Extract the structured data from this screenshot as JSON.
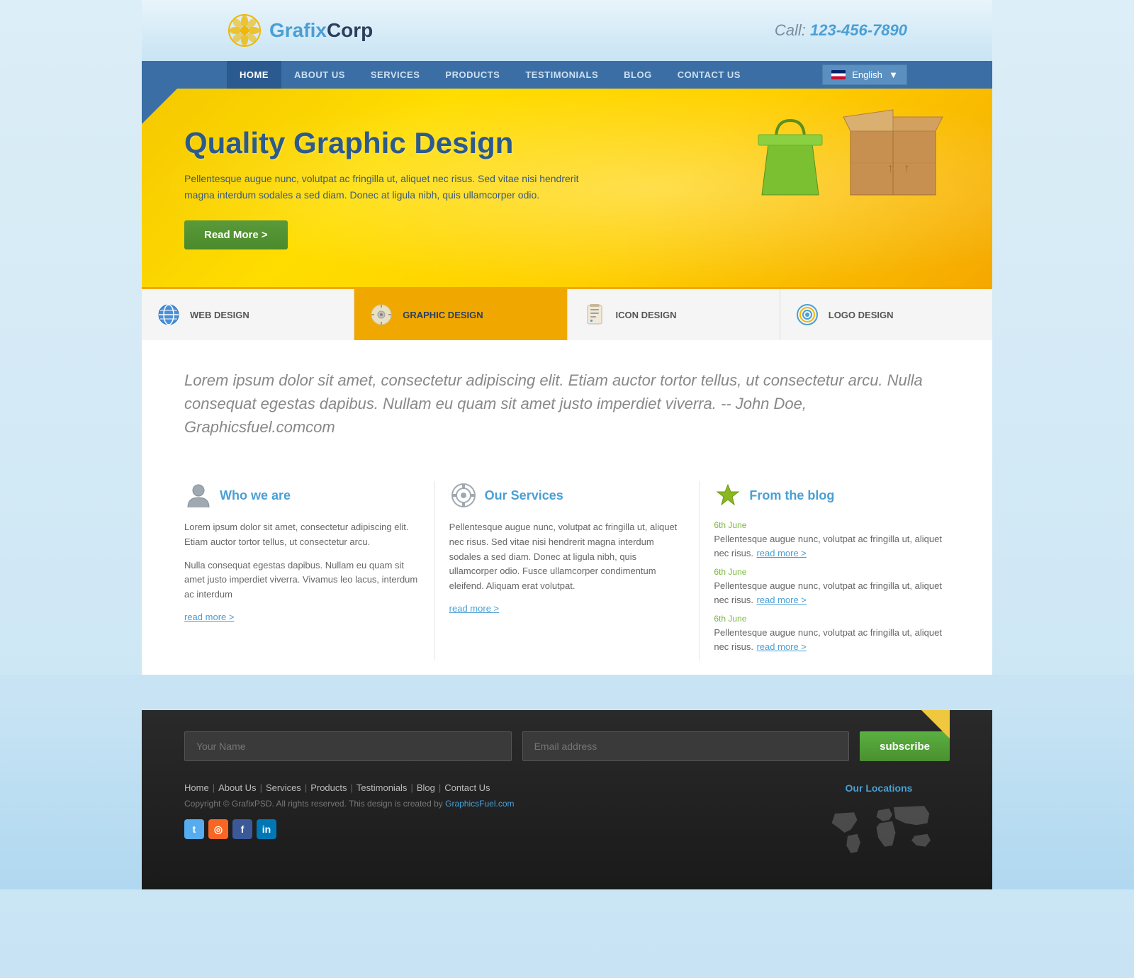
{
  "brand": {
    "name_part1": "Grafix",
    "name_part2": "Corp",
    "phone_label": "Call:",
    "phone_number": "123-456-7890"
  },
  "nav": {
    "items": [
      {
        "label": "HOME",
        "active": true
      },
      {
        "label": "ABOUT US",
        "active": false
      },
      {
        "label": "SERVICES",
        "active": false
      },
      {
        "label": "PRODUCTS",
        "active": false
      },
      {
        "label": "TESTIMONIALS",
        "active": false
      },
      {
        "label": "BLOG",
        "active": false
      },
      {
        "label": "CONTACT US",
        "active": false
      }
    ],
    "lang": "English"
  },
  "hero": {
    "title": "Quality Graphic Design",
    "text": "Pellentesque augue nunc, volutpat ac fringilla ut, aliquet nec risus. Sed vitae nisi hendrerit magna interdum sodales a sed diam. Donec at ligula nibh, quis ullamcorper odio.",
    "button_label": "Read More >"
  },
  "service_tabs": [
    {
      "label": "WEB DESIGN",
      "icon": "🌐"
    },
    {
      "label": "GRAPHIC DESIGN",
      "icon": "🕐",
      "active": true
    },
    {
      "label": "ICON DESIGN",
      "icon": "📋"
    },
    {
      "label": "LOGO DESIGN",
      "icon": "🎯"
    }
  ],
  "quote": {
    "text": "Lorem ipsum dolor sit amet, consectetur adipiscing elit. Etiam auctor tortor tellus, ut consectetur arcu. Nulla consequat egestas dapibus. Nullam eu quam sit amet justo imperdiet viverra.      --  John Doe, Graphicsfuel.comcom"
  },
  "columns": {
    "who_we_are": {
      "title": "Who we are",
      "text1": "Lorem ipsum dolor sit amet, consectetur adipiscing elit. Etiam auctor tortor tellus, ut consectetur arcu.",
      "text2": "Nulla consequat egestas dapibus. Nullam eu quam sit amet justo imperdiet viverra. Vivamus leo lacus, interdum ac interdum",
      "link": "read more >"
    },
    "our_services": {
      "title": "Our Services",
      "text": "Pellentesque augue nunc, volutpat ac fringilla ut, aliquet nec risus. Sed vitae nisi hendrerit magna interdum sodales a sed diam. Donec at ligula nibh, quis ullamcorper odio. Fusce ullamcorper condimentum eleifend. Aliquam erat volutpat.",
      "link": "read more >"
    },
    "from_the_blog": {
      "title": "From the blog",
      "entries": [
        {
          "date": "6th June",
          "text": "Pellentesque augue nunc, volutpat ac fringilla ut, aliquet nec risus.",
          "link": "read more >"
        },
        {
          "date": "6th June",
          "text": "Pellentesque augue nunc, volutpat ac fringilla ut, aliquet nec risus.",
          "link": "read more >"
        },
        {
          "date": "6th June",
          "text": "Pellentesque augue nunc, volutpat ac fringilla ut, aliquet nec risus.",
          "link": "read more >"
        }
      ]
    }
  },
  "footer": {
    "subscribe": {
      "name_placeholder": "Your Name",
      "email_placeholder": "Email address",
      "button_label": "subscribe"
    },
    "nav_links": [
      "Home",
      "About Us",
      "Services",
      "Products",
      "Testimonials",
      "Blog",
      "Contact Us"
    ],
    "copyright": "Copyright © GrafixPSD. All rights reserved. This design is created by",
    "copyright_link": "GraphicsFuel.com",
    "locations_title": "Our Locations",
    "social": [
      {
        "name": "twitter",
        "icon": "t"
      },
      {
        "name": "rss",
        "icon": "◎"
      },
      {
        "name": "facebook",
        "icon": "f"
      },
      {
        "name": "linkedin",
        "icon": "in"
      }
    ]
  }
}
